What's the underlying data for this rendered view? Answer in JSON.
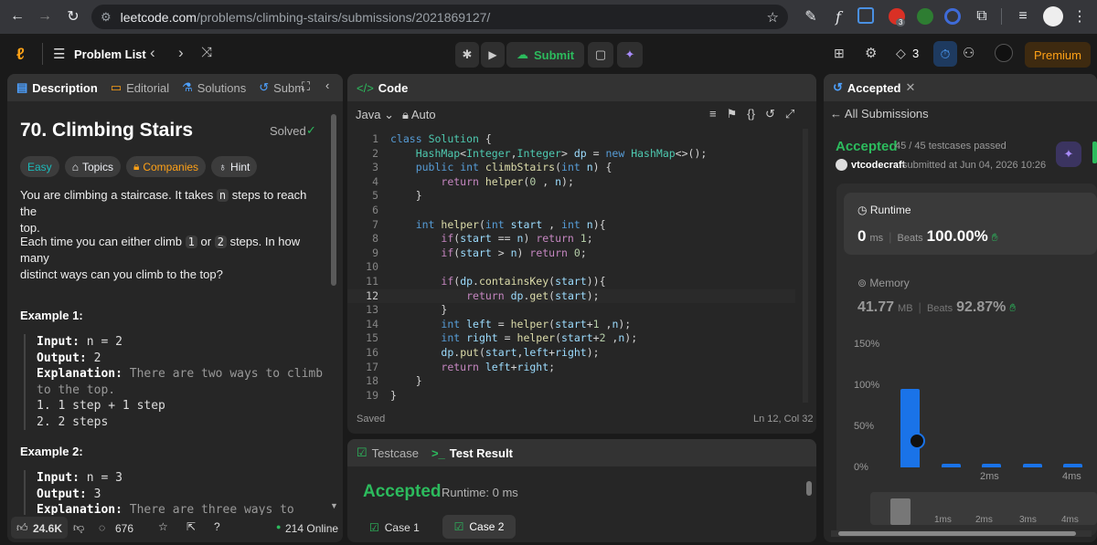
{
  "browser": {
    "url_host": "leetcode.com",
    "url_path": "/problems/climbing-stairs/submissions/2021869127/",
    "ext_badge": "3"
  },
  "nav": {
    "problem_list": "Problem List",
    "submit": "Submit",
    "streak": "3",
    "premium": "Premium"
  },
  "left": {
    "tabs": [
      "Description",
      "Editorial",
      "Solutions",
      "Subm"
    ],
    "title": "70. Climbing Stairs",
    "solved": "Solved",
    "chips": [
      "Easy",
      "Topics",
      "Companies",
      "Hint"
    ],
    "para1_a": "You are climbing a staircase. It takes",
    "para1_code": "n",
    "para1_b": "steps to reach the",
    "para1_c": "top.",
    "para2_a": "Each time you can either climb",
    "para2_code1": "1",
    "para2_or": "or",
    "para2_code2": "2",
    "para2_b": "steps. In how many",
    "para2_c": "distinct ways can you climb to the top?",
    "ex1_title": "Example 1:",
    "ex1_input_label": "Input:",
    "ex1_input": "n = 2",
    "ex1_output_label": "Output:",
    "ex1_output": "2",
    "ex1_expl_label": "Explanation:",
    "ex1_expl1": "There are two ways to climb",
    "ex1_expl2": "to the top.",
    "ex1_step1": "1. 1 step + 1 step",
    "ex1_step2": "2. 2 steps",
    "ex2_title": "Example 2:",
    "ex2_input_label": "Input:",
    "ex2_input": "n = 3",
    "ex2_output_label": "Output:",
    "ex2_output": "3",
    "ex2_expl_label": "Explanation:",
    "ex2_expl1": "There are three ways to climb",
    "likes": "24.6K",
    "comments": "676",
    "online": "214 Online"
  },
  "code": {
    "tab": "Code",
    "lang": "Java",
    "auto": "Auto",
    "status_left": "Saved",
    "status_right": "Ln 12, Col 32"
  },
  "testpanel": {
    "tab_testcase": "Testcase",
    "tab_result": "Test Result",
    "accepted": "Accepted",
    "runtime": "Runtime: 0 ms",
    "case1": "Case 1",
    "case2": "Case 2"
  },
  "right": {
    "tab": "Accepted",
    "all_submissions": "All Submissions",
    "accepted": "Accepted",
    "testcases": "45 / 45 testcases passed",
    "user": "vtcodecraft",
    "submitted": "submitted at Jun 04, 2026 10:26",
    "runtime_label": "Runtime",
    "runtime_value": "0",
    "runtime_unit": "ms",
    "beats_label": "Beats",
    "runtime_beats": "100.00%",
    "memory_label": "Memory",
    "memory_value": "41.77",
    "memory_unit": "MB",
    "memory_beats": "92.87%"
  },
  "chart_data": {
    "type": "bar",
    "yticks": [
      "150%",
      "100%",
      "50%",
      "0%"
    ],
    "ylim": [
      0,
      150
    ],
    "xticks": [
      "2ms",
      "4ms"
    ],
    "mini_xticks": [
      "1ms",
      "2ms",
      "3ms",
      "4ms"
    ],
    "categories": [
      "0ms",
      "1ms",
      "2ms",
      "3ms",
      "4ms"
    ],
    "values": [
      96,
      4,
      4,
      4,
      4
    ]
  }
}
